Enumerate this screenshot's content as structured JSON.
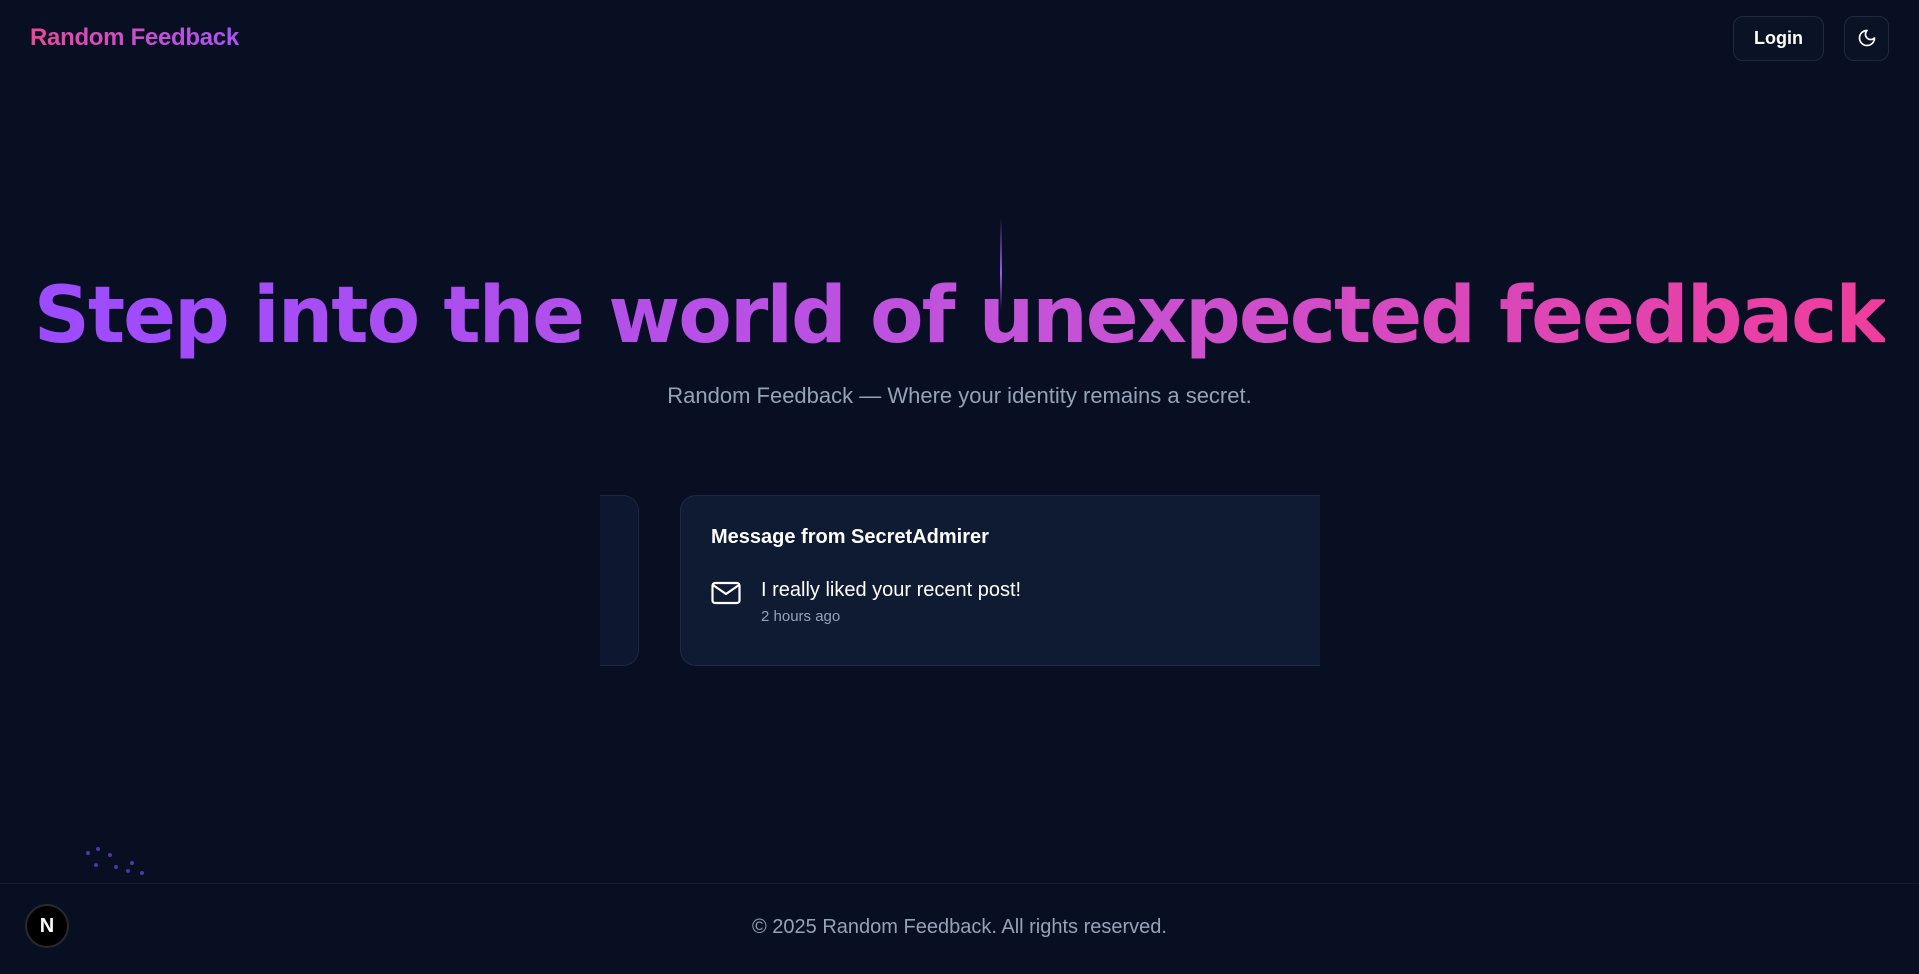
{
  "colors": {
    "background": "#080f22",
    "brand_gradient_start": "#ec4899",
    "brand_gradient_end": "#a855f7",
    "title_gradient_start": "#9c4bff",
    "title_gradient_end": "#ef3d9c",
    "muted_text": "#94a3b8",
    "card_background": "#0f1a33"
  },
  "navbar": {
    "brand": "Random Feedback",
    "login_label": "Login",
    "theme_toggle_icon": "moon-icon"
  },
  "hero": {
    "title": "Step into the world of unexpected feedback",
    "subtitle": "Random Feedback — Where your identity remains a secret."
  },
  "carousel": {
    "current": {
      "title": "Message from SecretAdmirer",
      "icon": "mail-icon",
      "message": "I really liked your recent post!",
      "time": "2 hours ago"
    }
  },
  "footer": {
    "copyright": "© 2025 Random Feedback. All rights reserved."
  },
  "dev_badge": {
    "label": "N"
  }
}
